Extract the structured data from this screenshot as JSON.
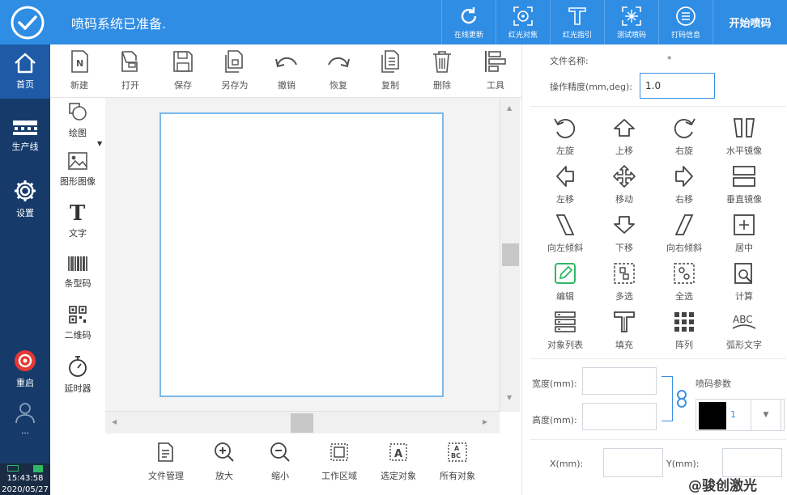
{
  "status": {
    "message": "喷码系统已准备."
  },
  "topbar": {
    "buttons": [
      {
        "label": "在线更新",
        "icon": "refresh-icon"
      },
      {
        "label": "红光对焦",
        "icon": "focus-target-icon"
      },
      {
        "label": "红光指引",
        "icon": "red-light-guide-icon"
      },
      {
        "label": "测试喷码",
        "icon": "test-print-icon"
      },
      {
        "label": "打码信息",
        "icon": "print-info-icon"
      }
    ],
    "start_label": "开始喷码"
  },
  "nav": {
    "items": [
      {
        "label": "首页",
        "icon": "home-icon"
      },
      {
        "label": "生产线",
        "icon": "production-line-icon"
      },
      {
        "label": "设置",
        "icon": "gear-icon"
      },
      {
        "label": "重启",
        "icon": "restart-icon"
      },
      {
        "label": "",
        "icon": "user-icon"
      }
    ],
    "ellipsis": "...",
    "time": "15:43:58",
    "date": "2020/05/27"
  },
  "edit_toolbar": [
    {
      "label": "新建",
      "icon": "new-file-icon"
    },
    {
      "label": "打开",
      "icon": "open-icon"
    },
    {
      "label": "保存",
      "icon": "save-icon"
    },
    {
      "label": "另存为",
      "icon": "save-as-icon"
    },
    {
      "label": "撤销",
      "icon": "undo-icon"
    },
    {
      "label": "恢复",
      "icon": "redo-icon"
    },
    {
      "label": "复制",
      "icon": "copy-icon"
    },
    {
      "label": "删除",
      "icon": "delete-icon"
    },
    {
      "label": "工具",
      "icon": "tools-icon"
    }
  ],
  "draw_tools": [
    {
      "label": "绘图",
      "icon": "draw-shapes-icon"
    },
    {
      "label": "图形图像",
      "icon": "image-icon"
    },
    {
      "label": "文字",
      "icon": "text-icon"
    },
    {
      "label": "条型码",
      "icon": "barcode-icon"
    },
    {
      "label": "二维码",
      "icon": "qrcode-icon"
    },
    {
      "label": "延时器",
      "icon": "timer-icon"
    }
  ],
  "view_toolbar": [
    {
      "label": "文件管理",
      "icon": "file-manage-icon"
    },
    {
      "label": "放大",
      "icon": "zoom-in-icon"
    },
    {
      "label": "缩小",
      "icon": "zoom-out-icon"
    },
    {
      "label": "工作区域",
      "icon": "work-area-icon"
    },
    {
      "label": "选定对象",
      "icon": "select-object-icon"
    },
    {
      "label": "所有对象",
      "icon": "all-objects-icon"
    }
  ],
  "right_panel": {
    "file_name_label": "文件名称:",
    "file_name_value": "*",
    "precision_label": "操作精度(mm,deg):",
    "precision_value": "1.0",
    "transforms": [
      {
        "label": "左旋",
        "icon": "rotate-left-icon"
      },
      {
        "label": "上移",
        "icon": "move-up-icon"
      },
      {
        "label": "右旋",
        "icon": "rotate-right-icon"
      },
      {
        "label": "水平镜像",
        "icon": "mirror-horizontal-icon"
      },
      {
        "label": "左移",
        "icon": "move-left-icon"
      },
      {
        "label": "移动",
        "icon": "move-icon"
      },
      {
        "label": "右移",
        "icon": "move-right-icon"
      },
      {
        "label": "垂直镜像",
        "icon": "mirror-vertical-icon"
      },
      {
        "label": "向左倾斜",
        "icon": "skew-left-icon"
      },
      {
        "label": "下移",
        "icon": "move-down-icon"
      },
      {
        "label": "向右倾斜",
        "icon": "skew-right-icon"
      },
      {
        "label": "居中",
        "icon": "center-icon"
      },
      {
        "label": "编辑",
        "icon": "edit-icon"
      },
      {
        "label": "多选",
        "icon": "multi-select-icon"
      },
      {
        "label": "全选",
        "icon": "select-all-icon"
      },
      {
        "label": "计算",
        "icon": "calculate-icon"
      },
      {
        "label": "对象列表",
        "icon": "object-list-icon"
      },
      {
        "label": "填充",
        "icon": "fill-icon"
      },
      {
        "label": "阵列",
        "icon": "array-icon"
      },
      {
        "label": "弧形文字",
        "icon": "arc-text-icon"
      }
    ],
    "width_label": "宽度(mm):",
    "height_label": "高度(mm):",
    "width_value": "",
    "height_value": "",
    "print_params_label": "喷码参数",
    "color_index": "1",
    "x_label": "X(mm):",
    "y_label": "Y(mm):",
    "x_value": "",
    "y_value": ""
  },
  "watermark": "@骏创激光",
  "colors": {
    "topbar": "#2f8de4",
    "nav": "#163b6b",
    "nav_active": "#1e5aa6",
    "accent_green": "#2fb865",
    "restart_red": "#e53935"
  }
}
